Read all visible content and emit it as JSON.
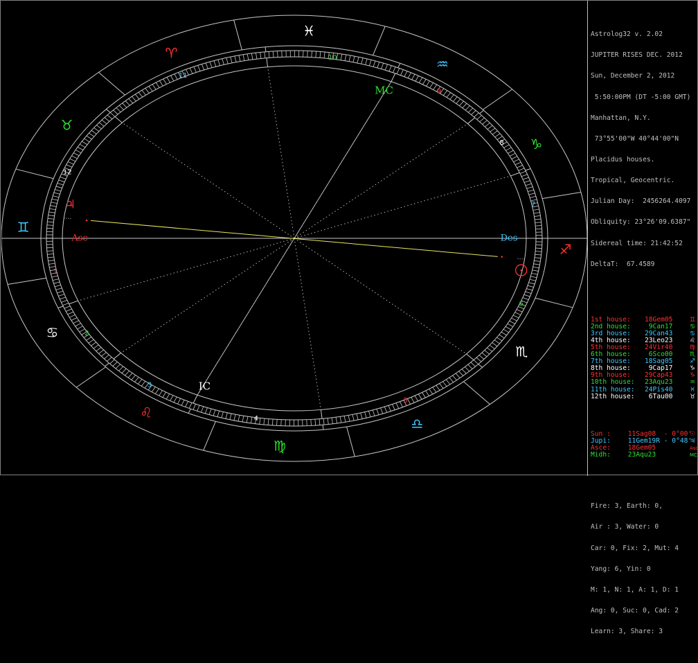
{
  "colors": {
    "background": "#000000",
    "line": "#c8c8c8",
    "white": "#ffffff",
    "gray": "#c0c0c0",
    "red": "#ff3030",
    "green": "#30e030",
    "cyan": "#40c8ff",
    "yellow": "#e8e860",
    "blue": "#5fb0ff"
  },
  "info": {
    "lines": [
      "Astrolog32 v. 2.02",
      "JUPITER RISES DEC. 2012",
      "Sun, December 2, 2012",
      " 5:50:00PM (DT -5:00 GMT)",
      "Manhattan, N.Y.",
      " 73°55'00\"W 40°44'00\"N",
      "Placidus houses.",
      "Tropical, Geocentric.",
      "Julian Day:  2456264.4097",
      "Obliquity: 23°26'09.6387\"",
      "Sidereal time: 21:42:52",
      "DeltaT:  67.4589"
    ]
  },
  "houses": [
    {
      "label": "1st house:",
      "cusp": "18Gem05",
      "sign": "♊",
      "color": "#ff3030"
    },
    {
      "label": "2nd house:",
      "cusp": " 9Can17",
      "sign": "♋",
      "color": "#30e030"
    },
    {
      "label": "3rd house:",
      "cusp": "29Can43",
      "sign": "♋",
      "color": "#40c8ff"
    },
    {
      "label": "4th house:",
      "cusp": "23Leo23",
      "sign": "♌",
      "color": "#ffffff"
    },
    {
      "label": "5th house:",
      "cusp": "24Vir40",
      "sign": "♍",
      "color": "#ff3030"
    },
    {
      "label": "6th house:",
      "cusp": " 6Sco00",
      "sign": "♏",
      "color": "#30e030"
    },
    {
      "label": "7th house:",
      "cusp": "18Sag05",
      "sign": "♐",
      "color": "#40c8ff"
    },
    {
      "label": "8th house:",
      "cusp": " 9Cap17",
      "sign": "♑",
      "color": "#ffffff"
    },
    {
      "label": "9th house:",
      "cusp": "29Cap43",
      "sign": "♑",
      "color": "#ff3030"
    },
    {
      "label": "10th house:",
      "cusp": "23Aqu23",
      "sign": "♒",
      "color": "#30e030"
    },
    {
      "label": "11th house:",
      "cusp": "24Pis40",
      "sign": "♓",
      "color": "#40c8ff"
    },
    {
      "label": "12th house:",
      "cusp": " 6Tau00",
      "sign": "♉",
      "color": "#ffffff"
    }
  ],
  "planets": [
    {
      "label": "Sun :",
      "value": " 11Sag08  - 0°00'",
      "sign": "☉",
      "color": "#ff3030"
    },
    {
      "label": "Jupi:",
      "value": " 11Gem19R - 0°48'",
      "sign": "♃",
      "color": "#40c8ff"
    },
    {
      "label": "Asce:",
      "value": " 18Gem05",
      "sign": "Asc",
      "color": "#ff3030"
    },
    {
      "label": "Midh:",
      "value": " 23Aqu23",
      "sign": "MC",
      "color": "#30e030"
    }
  ],
  "stats": [
    "Fire: 3, Earth: 0,",
    "Air : 3, Water: 0",
    "Car: 0, Fix: 2, Mut: 4",
    "Yang: 6, Yin: 0",
    "M: 1, N: 1, A: 1, D: 1",
    "Ang: 0, Suc: 0, Cad: 2",
    "Learn: 3, Share: 3"
  ],
  "chart": {
    "ascendant_lon": 78.08,
    "signs": [
      {
        "glyph": "♈",
        "color": "#ff3030"
      },
      {
        "glyph": "♉",
        "color": "#30e030"
      },
      {
        "glyph": "♊",
        "color": "#40c8ff"
      },
      {
        "glyph": "♋",
        "color": "#ffffff"
      },
      {
        "glyph": "♌",
        "color": "#ff3030"
      },
      {
        "glyph": "♍",
        "color": "#30e030"
      },
      {
        "glyph": "♎",
        "color": "#40c8ff"
      },
      {
        "glyph": "♏",
        "color": "#ffffff"
      },
      {
        "glyph": "♐",
        "color": "#ff3030"
      },
      {
        "glyph": "♑",
        "color": "#30e030"
      },
      {
        "glyph": "♒",
        "color": "#40c8ff"
      },
      {
        "glyph": "♓",
        "color": "#ffffff"
      }
    ],
    "cusps": [
      78.08,
      99.28,
      119.72,
      143.38,
      174.67,
      216.0,
      258.08,
      279.28,
      299.72,
      323.38,
      354.67,
      36.0
    ],
    "house_numbers": [
      {
        "n": "1",
        "color": "#ff3030"
      },
      {
        "n": "2",
        "color": "#30e030"
      },
      {
        "n": "3",
        "color": "#40c8ff"
      },
      {
        "n": "4",
        "color": "#ffffff"
      },
      {
        "n": "5",
        "color": "#ff3030"
      },
      {
        "n": "6",
        "color": "#30e030"
      },
      {
        "n": "7",
        "color": "#40c8ff"
      },
      {
        "n": "8",
        "color": "#ffffff"
      },
      {
        "n": "9",
        "color": "#ff3030"
      },
      {
        "n": "10",
        "color": "#30e030"
      },
      {
        "n": "11",
        "color": "#40c8ff"
      },
      {
        "n": "12",
        "color": "#ffffff"
      }
    ],
    "angles": [
      {
        "label": "Asc",
        "lon": 78.08,
        "color": "#ff3030"
      },
      {
        "label": "Des",
        "lon": 258.08,
        "color": "#40c8ff"
      },
      {
        "label": "MC",
        "lon": 323.38,
        "color": "#30e030"
      },
      {
        "label": "IC",
        "lon": 143.38,
        "color": "#ffffff"
      }
    ],
    "chart_planets": [
      {
        "glyph": "♃",
        "lon": 71.32,
        "color": "#ff3030"
      },
      {
        "glyph": "☉",
        "lon": 251.13,
        "color": "#ff3030"
      }
    ]
  }
}
